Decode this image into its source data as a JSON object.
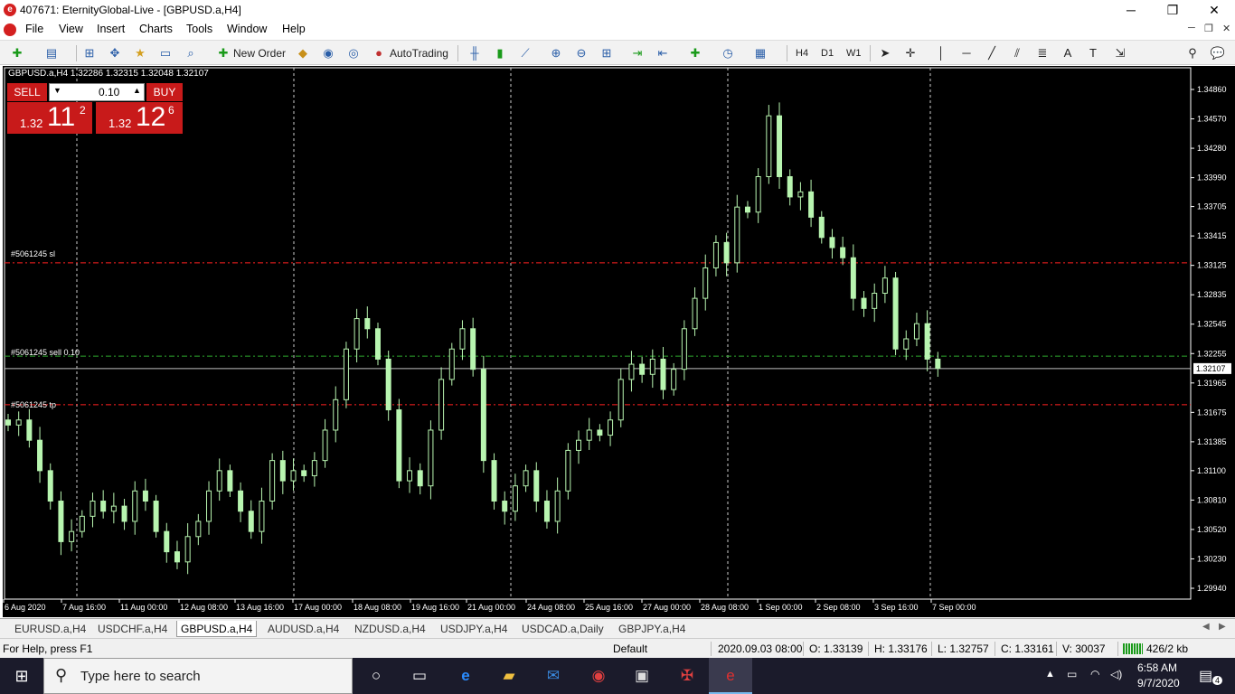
{
  "window": {
    "title": "407671: EternityGlobal-Live - [GBPUSD.a,H4]",
    "minimize": "─",
    "maximize": "❐",
    "close": "✕"
  },
  "menu": [
    "File",
    "View",
    "Insert",
    "Charts",
    "Tools",
    "Window",
    "Help"
  ],
  "toolbar": {
    "new_order": "New Order",
    "autotrading": "AutoTrading",
    "tf_h4": "H4",
    "tf_d1": "D1",
    "tf_w1": "W1"
  },
  "chart": {
    "info": "GBPUSD.a,H4  1.32286 1.32315 1.32048 1.32107",
    "sell_label": "SELL",
    "buy_label": "BUY",
    "lot": "0.10",
    "bid_small": "1.32",
    "bid_big": "11",
    "bid_sup": "2",
    "ask_small": "1.32",
    "ask_big": "12",
    "ask_sup": "6",
    "sl_label": "#5061245 sl",
    "order_label": "#5061245 sell 0.10",
    "tp_label": "#5061245 tp",
    "current_price": "1.32107",
    "colors": {
      "bg": "#000000",
      "candle": "#b8f5b0",
      "sl": "#ff2020",
      "order": "#2ea82e",
      "price": "#c0c0c0",
      "grid": "#ffffff"
    }
  },
  "chart_data": {
    "type": "candlestick",
    "symbol": "GBPUSD.a",
    "timeframe": "H4",
    "y_ticks": [
      1.3486,
      1.3457,
      1.3428,
      1.3399,
      1.33705,
      1.33415,
      1.33125,
      1.32835,
      1.32545,
      1.32255,
      1.31965,
      1.31675,
      1.31385,
      1.311,
      1.3081,
      1.3052,
      1.3023,
      1.2994
    ],
    "ylim": [
      1.2994,
      1.3486
    ],
    "x_ticks": [
      "6 Aug 2020",
      "7 Aug 16:00",
      "11 Aug 00:00",
      "12 Aug 08:00",
      "13 Aug 16:00",
      "17 Aug 00:00",
      "18 Aug 08:00",
      "19 Aug 16:00",
      "21 Aug 00:00",
      "24 Aug 08:00",
      "25 Aug 16:00",
      "27 Aug 00:00",
      "28 Aug 08:00",
      "1 Sep 00:00",
      "2 Sep 08:00",
      "3 Sep 16:00",
      "7 Sep 00:00"
    ],
    "levels": {
      "sl": 1.3315,
      "order": 1.3223,
      "tp": 1.3175,
      "current": 1.32107
    },
    "closes": [
      1.3155,
      1.316,
      1.314,
      1.311,
      1.308,
      1.304,
      1.305,
      1.3065,
      1.308,
      1.307,
      1.3075,
      1.306,
      1.309,
      1.308,
      1.305,
      1.303,
      1.302,
      1.3045,
      1.306,
      1.309,
      1.311,
      1.309,
      1.307,
      1.305,
      1.308,
      1.312,
      1.31,
      1.311,
      1.3105,
      1.312,
      1.315,
      1.318,
      1.323,
      1.326,
      1.325,
      1.322,
      1.317,
      1.31,
      1.311,
      1.3095,
      1.315,
      1.32,
      1.323,
      1.325,
      1.321,
      1.312,
      1.308,
      1.307,
      1.3095,
      1.311,
      1.308,
      1.306,
      1.309,
      1.313,
      1.314,
      1.315,
      1.3145,
      1.316,
      1.32,
      1.3215,
      1.3205,
      1.322,
      1.319,
      1.321,
      1.325,
      1.328,
      1.331,
      1.3335,
      1.3315,
      1.337,
      1.3365,
      1.34,
      1.346,
      1.34,
      1.338,
      1.3385,
      1.336,
      1.334,
      1.333,
      1.332,
      1.328,
      1.327,
      1.3285,
      1.33,
      1.323,
      1.324,
      1.3255,
      1.322,
      1.3211
    ]
  },
  "tabs": [
    "EURUSD.a,H4",
    "USDCHF.a,H4",
    "GBPUSD.a,H4",
    "AUDUSD.a,H4",
    "NZDUSD.a,H4",
    "USDJPY.a,H4",
    "USDCAD.a,Daily",
    "GBPJPY.a,H4"
  ],
  "status": {
    "help": "For Help, press F1",
    "profile": "Default",
    "time": "2020.09.03 08:00",
    "open": "O: 1.33139",
    "high": "H: 1.33176",
    "low": "L: 1.32757",
    "close": "C: 1.33161",
    "volume": "V: 30037",
    "traffic": "426/2 kb"
  },
  "taskbar": {
    "search_placeholder": "Type here to search",
    "time": "6:58 AM",
    "date": "9/7/2020",
    "notifications": "4"
  }
}
